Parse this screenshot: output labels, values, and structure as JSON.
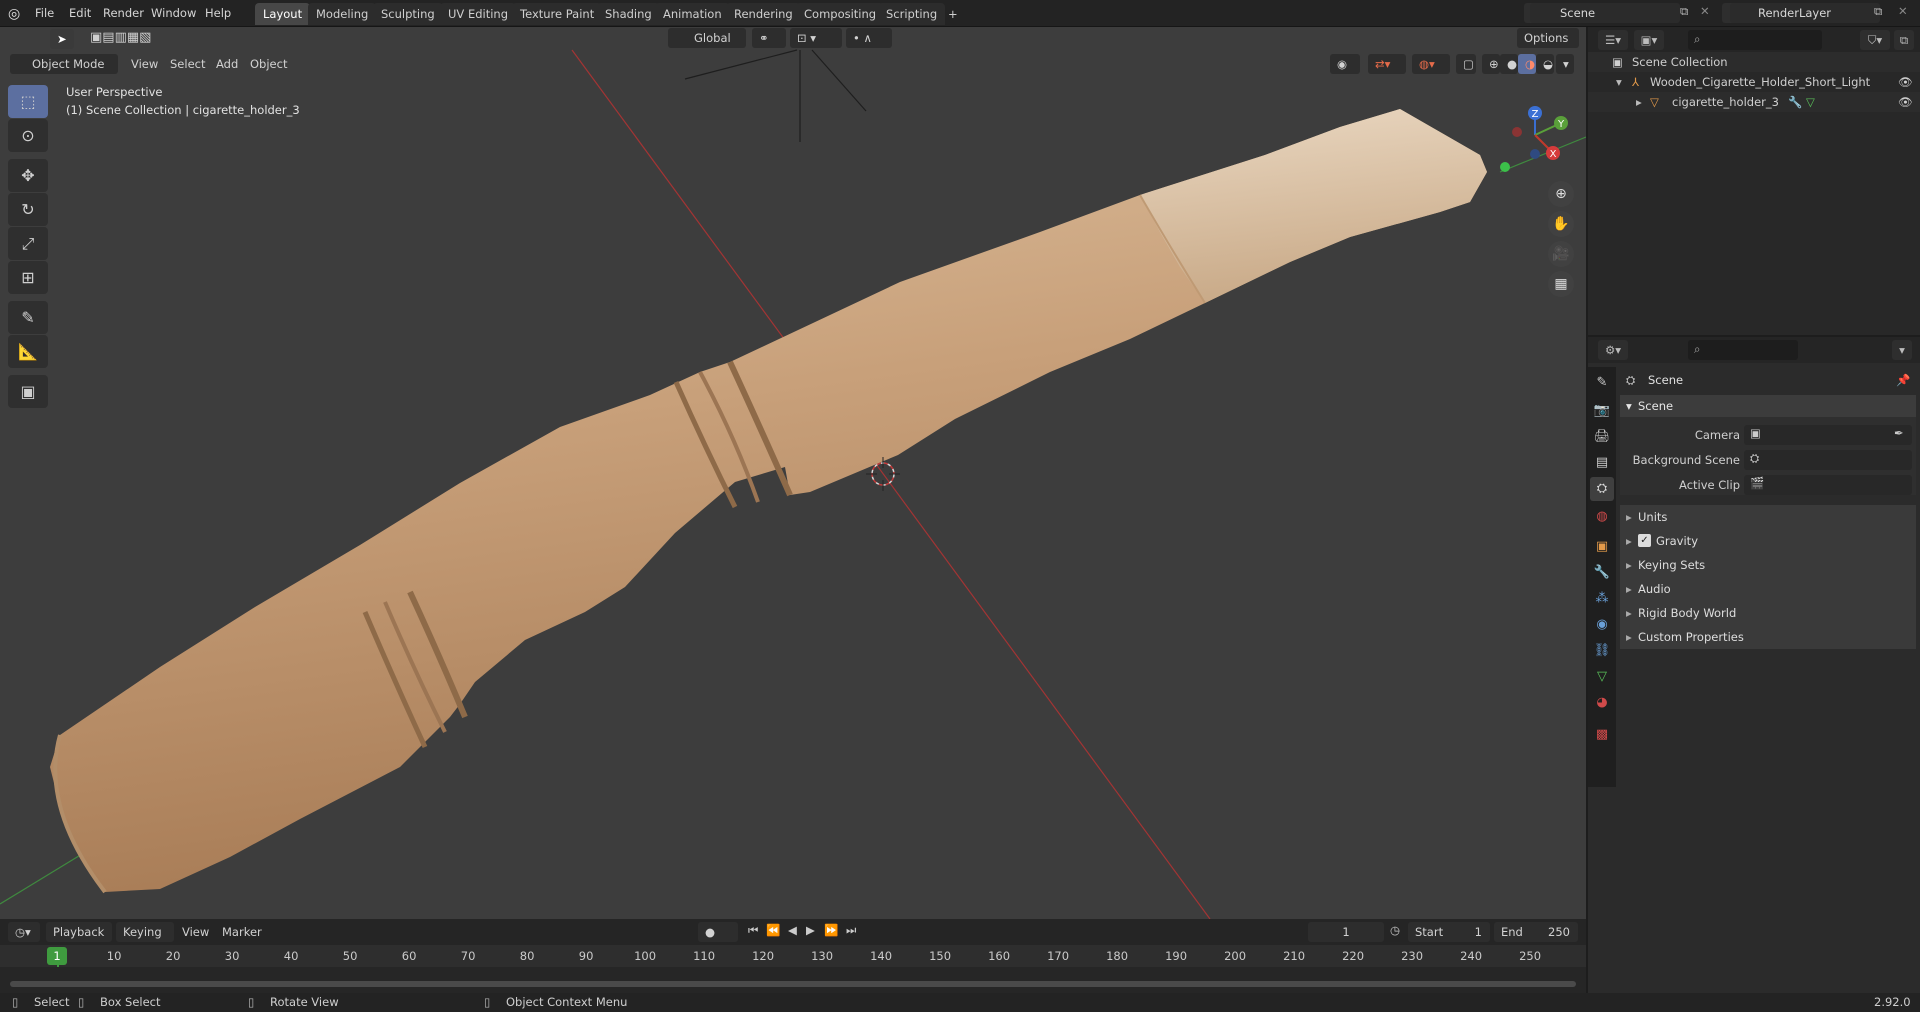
{
  "menubar": {
    "items": [
      "File",
      "Edit",
      "Render",
      "Window",
      "Help"
    ],
    "tabs": [
      "Layout",
      "Modeling",
      "Sculpting",
      "UV Editing",
      "Texture Paint",
      "Shading",
      "Animation",
      "Rendering",
      "Compositing",
      "Scripting"
    ],
    "active_tab": "Layout",
    "add_tab": "+",
    "scene": "Scene",
    "view_layer": "RenderLayer"
  },
  "viewport": {
    "mode": "Object Mode",
    "menus": [
      "View",
      "Select",
      "Add",
      "Object"
    ],
    "transform_orientation": "Global",
    "options": "Options",
    "overlay_title": "User Perspective",
    "overlay_subtitle": "(1) Scene Collection | cigarette_holder_3",
    "gizmo_axes": {
      "x": "X",
      "y": "Y",
      "z": "Z"
    }
  },
  "outliner": {
    "root": "Scene Collection",
    "items": [
      {
        "name": "Wooden_Cigarette_Holder_Short_Light"
      },
      {
        "name": "cigarette_holder_3"
      }
    ]
  },
  "properties": {
    "context": "Scene",
    "panel": "Scene",
    "fields": [
      {
        "label": "Camera"
      },
      {
        "label": "Background Scene"
      },
      {
        "label": "Active Clip"
      }
    ],
    "subpanels": [
      "Units",
      "Gravity",
      "Keying Sets",
      "Audio",
      "Rigid Body World",
      "Custom Properties"
    ]
  },
  "timeline": {
    "menus": [
      "Playback",
      "Keying",
      "View",
      "Marker"
    ],
    "current_frame": "1",
    "start_label": "Start",
    "start": "1",
    "end_label": "End",
    "end": "250",
    "ticks": [
      "1",
      "10",
      "20",
      "30",
      "40",
      "50",
      "60",
      "70",
      "80",
      "90",
      "100",
      "110",
      "120",
      "130",
      "140",
      "150",
      "160",
      "170",
      "180",
      "190",
      "200",
      "210",
      "220",
      "230",
      "240",
      "250"
    ]
  },
  "statusbar": {
    "select": "Select",
    "box_select": "Box Select",
    "rotate": "Rotate View",
    "context_menu": "Object Context Menu",
    "version": "2.92.0"
  }
}
